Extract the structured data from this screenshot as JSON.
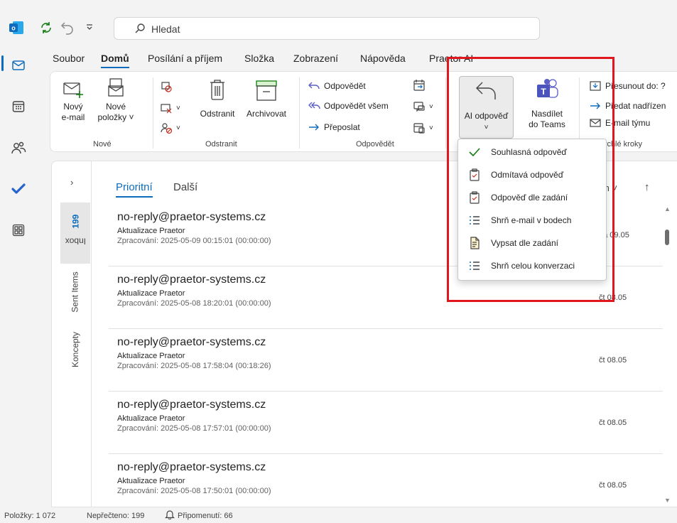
{
  "titlebar": {
    "search_placeholder": "Hledat"
  },
  "menu_tabs": [
    "Soubor",
    "Domů",
    "Posílání a příjem",
    "Složka",
    "Zobrazení",
    "Nápověda",
    "Praetor AI"
  ],
  "ribbon": {
    "new_email": [
      "Nový",
      "e-mail"
    ],
    "new_items": [
      "Nové",
      "položky"
    ],
    "delete": "Odstranit",
    "archive": "Archivovat",
    "reply": "Odpovědět",
    "reply_all": "Odpovědět všem",
    "forward": "Přeposlat",
    "ai_reply": "AI odpověď",
    "share_teams": [
      "Nasdílet",
      "do Teams"
    ],
    "move_to": "Přesunout do: ?",
    "to_manager": "Předat nadřízen",
    "team_email": "E-mail týmu",
    "groups": {
      "new": "Nové",
      "delete": "Odstranit",
      "respond": "Odpovědět",
      "quick_steps": "Rychlé kroky"
    }
  },
  "dropdown": {
    "items": [
      "Souhlasná odpověď",
      "Odmítavá odpověď",
      "Odpověď dle zadání",
      "Shrň e-mail v bodech",
      "Vypsat dle zadání",
      "Shrň celou konverzaci"
    ]
  },
  "folders": {
    "inbox": "Inbox",
    "inbox_count": "199",
    "sent": "Sent Items",
    "drafts": "Koncepty"
  },
  "pivot": {
    "focused": "Prioritní",
    "other": "Další"
  },
  "messages": [
    {
      "from": "no-reply@praetor-systems.cz",
      "subject": "Aktualizace Praetor",
      "preview": "Zpracování: 2025-05-09 00:15:01 (00:00:00)",
      "date": "pá 09.05"
    },
    {
      "from": "no-reply@praetor-systems.cz",
      "subject": "Aktualizace Praetor",
      "preview": "Zpracování: 2025-05-08 18:20:01 (00:00:00)",
      "date": "čt 08.05"
    },
    {
      "from": "no-reply@praetor-systems.cz",
      "subject": "Aktualizace Praetor",
      "preview": "Zpracování: 2025-05-08 17:58:04 (00:18:26)",
      "date": "čt 08.05"
    },
    {
      "from": "no-reply@praetor-systems.cz",
      "subject": "Aktualizace Praetor",
      "preview": "Zpracování: 2025-05-08 17:57:01 (00:00:00)",
      "date": "čt 08.05"
    },
    {
      "from": "no-reply@praetor-systems.cz",
      "subject": "Aktualizace Praetor",
      "preview": "Zpracování: 2025-05-08 17:50:01 (00:00:00)",
      "date": "čt 08.05"
    }
  ],
  "status": {
    "items": "Položky: 1 072",
    "unread": "Nepřečteno: 199",
    "reminders": "Připomenutí: 66"
  },
  "colors": {
    "accent": "#0f6cbd",
    "highlight_box": "#e2171d",
    "teams": "#5b5fc7"
  },
  "icons": [
    "outlook-logo-icon",
    "sync-icon",
    "undo-icon",
    "customize-icon",
    "search-icon",
    "mail-icon",
    "calendar-icon",
    "people-icon",
    "todo-icon",
    "apps-icon"
  ]
}
